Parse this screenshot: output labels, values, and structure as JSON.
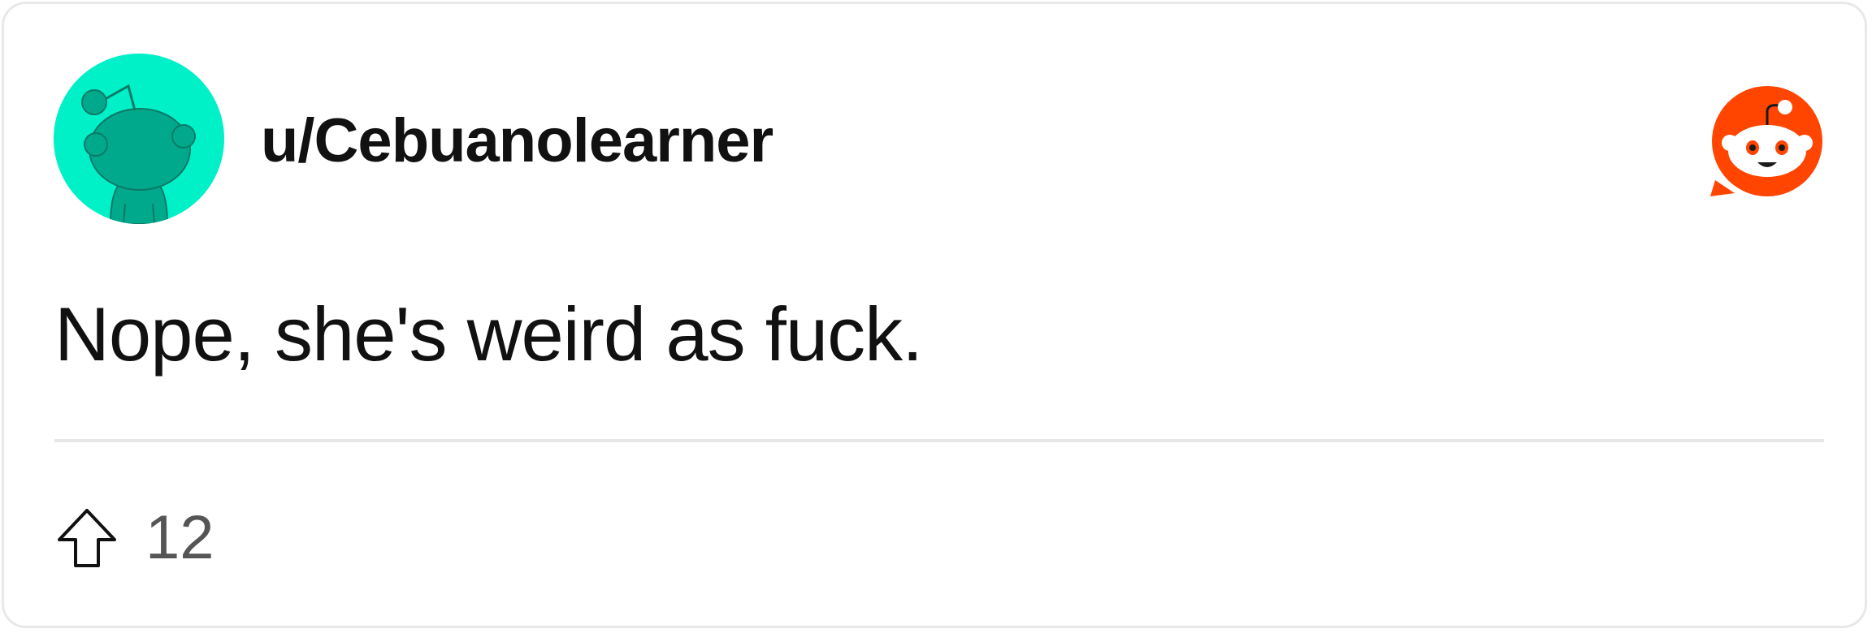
{
  "post": {
    "username": "u/Cebuanolearner",
    "body": "Nope, she's weird as fuck.",
    "upvotes": "12"
  },
  "icons": {
    "avatar": "snoo-avatar-icon",
    "brand": "reddit-logo-icon",
    "upvote": "upvote-arrow-icon"
  },
  "colors": {
    "avatar_bg": "#00f0c8",
    "avatar_snoo": "#00a88c",
    "reddit_orange": "#ff4500",
    "divider": "#e6e6e6",
    "text": "#111111",
    "count_text": "#555555"
  }
}
